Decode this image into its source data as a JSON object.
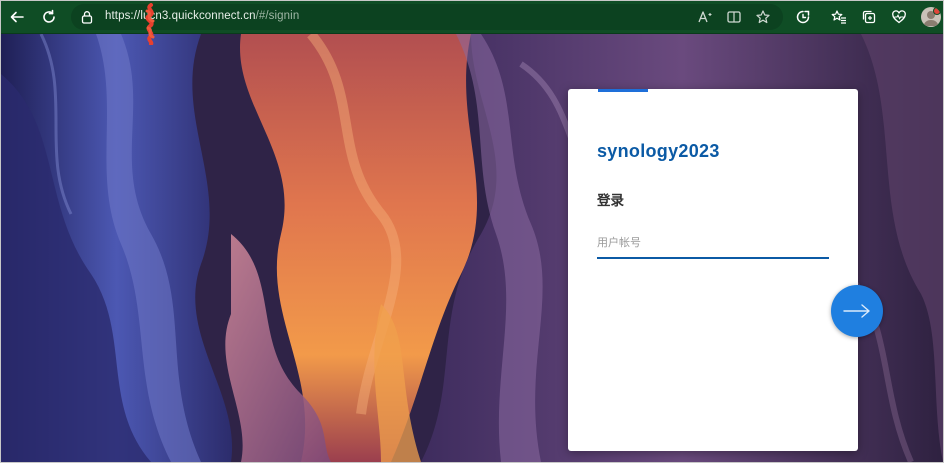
{
  "browser": {
    "url_prefix": "https://lu",
    "url_host": "cn3.quickconnect.cn",
    "url_path": "/#/signin",
    "icons": {
      "back": "arrow-left-icon",
      "reload": "reload-icon",
      "lock": "lock-icon",
      "read_aloud": "read-aloud-icon",
      "reader": "reader-mode-icon",
      "favorite": "star-icon",
      "extension": "extension-icon",
      "favorites": "favorites-icon",
      "collections": "collections-icon",
      "copilot": "heart-pulse-icon",
      "profile": "avatar"
    }
  },
  "login": {
    "title": "synology2023",
    "subtitle": "登录",
    "username_placeholder": "用户帐号",
    "username_value": "",
    "next_icon": "arrow-right-icon"
  },
  "colors": {
    "toolbar": "#0f4d25",
    "title": "#0b5aa5",
    "input_underline": "#0b5aa5",
    "next_button": "#1f7fe0",
    "card_accent": "#1e6fd9"
  }
}
